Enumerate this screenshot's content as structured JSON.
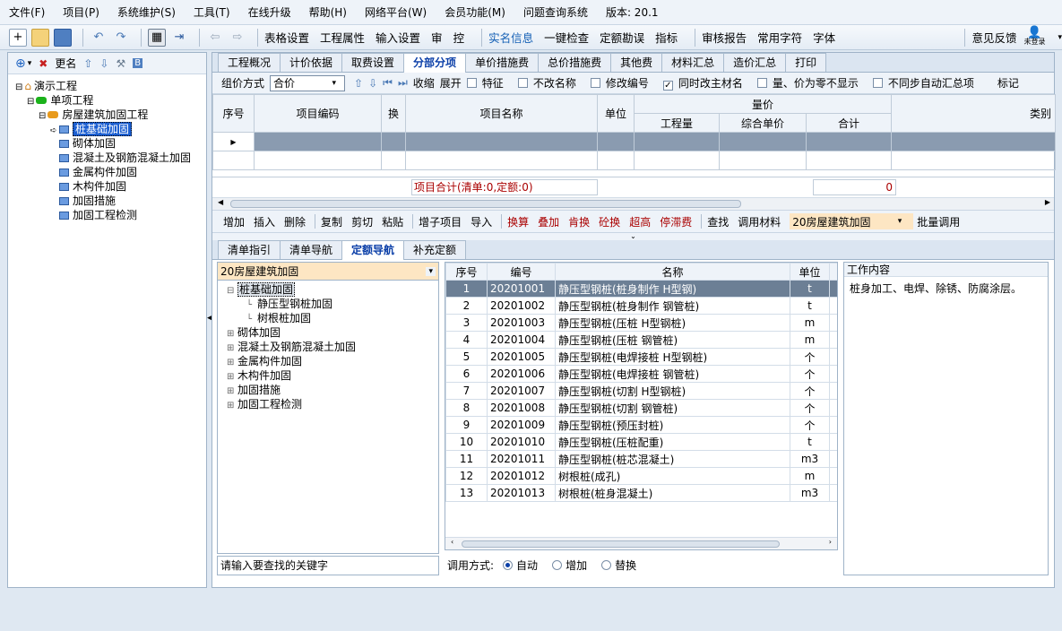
{
  "menu": [
    "文件(F)",
    "项目(P)",
    "系统维护(S)",
    "工具(T)",
    "在线升级",
    "帮助(H)",
    "网络平台(W)",
    "会员功能(M)",
    "问题查询系统",
    "版本: 20.1"
  ],
  "toolbar": {
    "buttons": [
      "表格设置",
      "工程属性",
      "输入设置",
      "审",
      "控",
      "实名信息",
      "一键检查",
      "定额勘误",
      "指标",
      "审核报告",
      "常用字符",
      "字体"
    ],
    "feedback": "意见反馈",
    "login": "未登录"
  },
  "left": {
    "tools": {
      "rename": "更名"
    },
    "tree": [
      {
        "label": "演示工程",
        "level": 0,
        "type": "home"
      },
      {
        "label": "单项工程",
        "level": 1,
        "type": "green"
      },
      {
        "label": "房屋建筑加固工程",
        "level": 2,
        "type": "orange"
      },
      {
        "label": "桩基础加固",
        "level": 3,
        "type": "item",
        "selected": true
      },
      {
        "label": "砌体加固",
        "level": 3,
        "type": "item"
      },
      {
        "label": "混凝土及钢筋混凝土加固",
        "level": 3,
        "type": "item"
      },
      {
        "label": "金属构件加固",
        "level": 3,
        "type": "item"
      },
      {
        "label": "木构件加固",
        "level": 3,
        "type": "item"
      },
      {
        "label": "加固措施",
        "level": 3,
        "type": "item"
      },
      {
        "label": "加固工程检测",
        "level": 3,
        "type": "item"
      }
    ]
  },
  "tabs": [
    "工程概况",
    "计价依据",
    "取费设置",
    "分部分项",
    "单价措施费",
    "总价措施费",
    "其他费",
    "材料汇总",
    "造价汇总",
    "打印"
  ],
  "active_tab": "分部分项",
  "options": {
    "group_label": "组价方式",
    "group_value": "合价",
    "collapse": "收缩",
    "expand": "展开",
    "checks": [
      {
        "label": "特征",
        "checked": false
      },
      {
        "label": "不改名称",
        "checked": false
      },
      {
        "label": "修改编号",
        "checked": false
      },
      {
        "label": "同时改主材名",
        "checked": true
      },
      {
        "label": "量、价为零不显示",
        "checked": false
      },
      {
        "label": "不同步自动汇总项",
        "checked": false
      }
    ],
    "mark": "标记"
  },
  "upper_grid": {
    "h_seq": "序号",
    "h_code": "项目编码",
    "h_swap": "换",
    "h_name": "项目名称",
    "h_unit": "单位",
    "h_quantity_group": "量价",
    "h_qty": "工程量",
    "h_uprice": "综合单价",
    "h_total": "合计",
    "h_type": "类别",
    "summary": "项目合计(清单:0,定额:0)",
    "summary_value": "0"
  },
  "commands": [
    "增加",
    "插入",
    "删除",
    "复制",
    "剪切",
    "粘贴",
    "增子项目",
    "导入",
    "换算",
    "叠加",
    "肯换",
    "砼换",
    "超高",
    "停滞费",
    "查找",
    "调用材料"
  ],
  "command_combo": "20房屋建筑加固",
  "batch": "批量调用",
  "subtabs": [
    "清单指引",
    "清单导航",
    "定额导航",
    "补充定额"
  ],
  "active_subtab": "定额导航",
  "quota_combo": "20房屋建筑加固",
  "quota_tree": [
    {
      "label": "桩基础加固",
      "level": 0,
      "sign": "⊟",
      "selected": true
    },
    {
      "label": "静压型钢桩加固",
      "level": 1,
      "sign": ""
    },
    {
      "label": "树根桩加固",
      "level": 1,
      "sign": ""
    },
    {
      "label": "砌体加固",
      "level": 0,
      "sign": "⊞"
    },
    {
      "label": "混凝土及钢筋混凝土加固",
      "level": 0,
      "sign": "⊞"
    },
    {
      "label": "金属构件加固",
      "level": 0,
      "sign": "⊞"
    },
    {
      "label": "木构件加固",
      "level": 0,
      "sign": "⊞"
    },
    {
      "label": "加固措施",
      "level": 0,
      "sign": "⊞"
    },
    {
      "label": "加固工程检测",
      "level": 0,
      "sign": "⊞"
    }
  ],
  "search_placeholder": "请输入要查找的关键字",
  "quota_grid": {
    "headers": [
      "序号",
      "编号",
      "名称",
      "单位"
    ],
    "rows": [
      [
        "1",
        "20201001",
        "静压型钢桩(桩身制作 H型钢)",
        "t"
      ],
      [
        "2",
        "20201002",
        "静压型钢桩(桩身制作 钢管桩)",
        "t"
      ],
      [
        "3",
        "20201003",
        "静压型钢桩(压桩 H型钢桩)",
        "m"
      ],
      [
        "4",
        "20201004",
        "静压型钢桩(压桩 钢管桩)",
        "m"
      ],
      [
        "5",
        "20201005",
        "静压型钢桩(电焊接桩 H型钢桩)",
        "个"
      ],
      [
        "6",
        "20201006",
        "静压型钢桩(电焊接桩 钢管桩)",
        "个"
      ],
      [
        "7",
        "20201007",
        "静压型钢桩(切割 H型钢桩)",
        "个"
      ],
      [
        "8",
        "20201008",
        "静压型钢桩(切割 钢管桩)",
        "个"
      ],
      [
        "9",
        "20201009",
        "静压型钢桩(预压封桩)",
        "个"
      ],
      [
        "10",
        "20201010",
        "静压型钢桩(压桩配重)",
        "t"
      ],
      [
        "11",
        "20201011",
        "静压型钢桩(桩芯混凝土)",
        "m3"
      ],
      [
        "12",
        "20201012",
        "树根桩(成孔)",
        "m"
      ],
      [
        "13",
        "20201013",
        "树根桩(桩身混凝土)",
        "m3"
      ]
    ]
  },
  "work": {
    "title": "工作内容",
    "content": "桩身加工、电焊、除锈、防腐涂层。"
  },
  "call_mode": {
    "label": "调用方式:",
    "options": [
      "自动",
      "增加",
      "替换"
    ],
    "selected": "自动"
  }
}
